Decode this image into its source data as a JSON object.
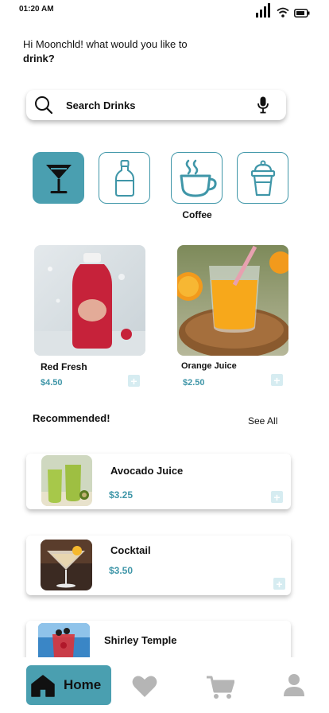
{
  "status": {
    "time": "01:20 AM"
  },
  "greeting": {
    "prefix": "Hi Moonchld! what would you like to ",
    "emphasis": "drink?"
  },
  "search": {
    "placeholder": "Search Drinks"
  },
  "categories": [
    {
      "id": "cocktail",
      "icon": "cocktail-glass-icon",
      "active": true
    },
    {
      "id": "bottle",
      "icon": "bottle-icon",
      "active": false
    },
    {
      "id": "coffee",
      "icon": "coffee-cup-icon",
      "active": false,
      "label": "Coffee"
    },
    {
      "id": "milkshake",
      "icon": "milkshake-cup-icon",
      "active": false
    }
  ],
  "products": [
    {
      "name": "Red Fresh",
      "price": "$4.50"
    },
    {
      "name": "Orange Juice",
      "price": "$2.50"
    }
  ],
  "recommended": {
    "title": "Recommended!",
    "see_all": "See All",
    "items": [
      {
        "name": "Avocado Juice",
        "price": "$3.25"
      },
      {
        "name": "Cocktail",
        "price": "$3.50"
      },
      {
        "name": "Shirley Temple",
        "price": ""
      }
    ]
  },
  "nav": {
    "home_label": "Home"
  },
  "colors": {
    "accent": "#4a9fb0",
    "price": "#3f96a8",
    "plus_bg": "#d6ecf1",
    "nav_inactive": "#b5b5b5"
  }
}
